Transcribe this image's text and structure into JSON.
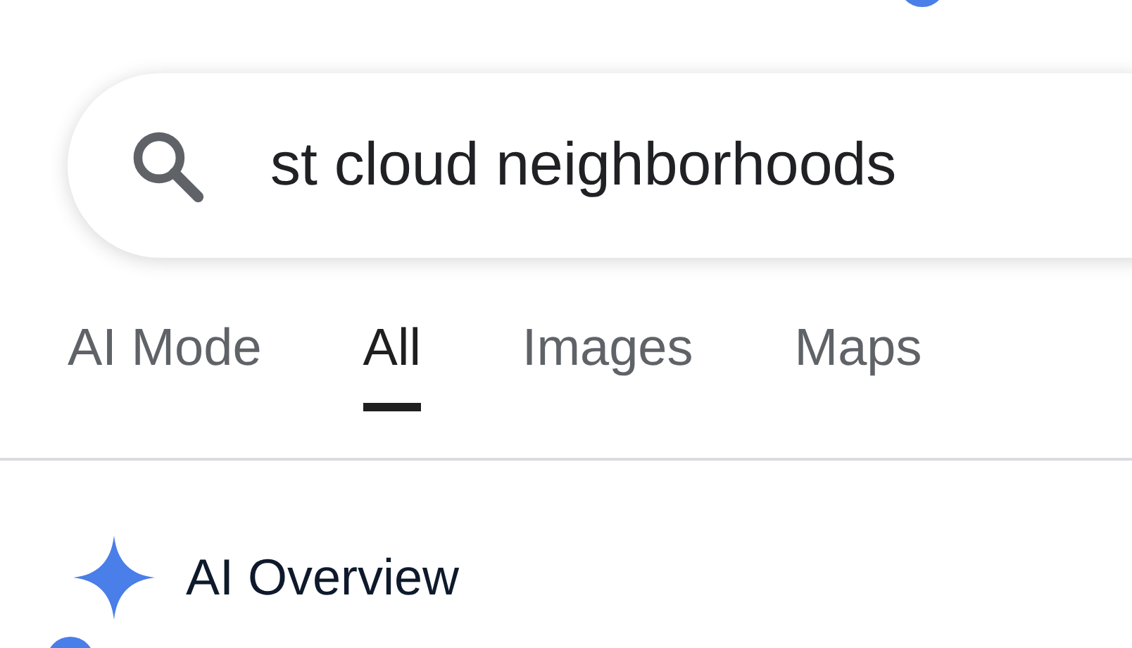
{
  "search": {
    "value": "st cloud neighborhoods"
  },
  "tabs": [
    {
      "label": "AI Mode",
      "selected": false
    },
    {
      "label": "All",
      "selected": true
    },
    {
      "label": "Images",
      "selected": false
    },
    {
      "label": "Maps",
      "selected": false
    }
  ],
  "ai_overview": {
    "title": "AI Overview"
  }
}
